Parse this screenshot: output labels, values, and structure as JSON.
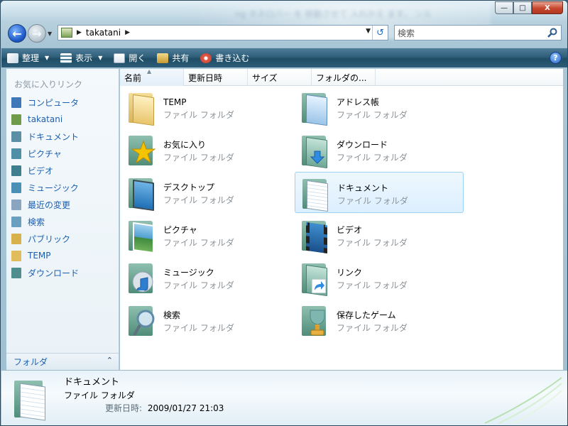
{
  "window": {
    "title_blur_text": "ng ネネロバー を 移動させて 入れかえ ます。 ンル",
    "controls": {
      "minimize": "—",
      "maximize": "□",
      "close": "X"
    }
  },
  "nav": {
    "address": {
      "crumb": "takatani"
    },
    "search": {
      "placeholder": "検索"
    }
  },
  "toolbar": {
    "organize": "整理",
    "views": "表示",
    "open": "開く",
    "share": "共有",
    "burn": "書き込む",
    "help": "?"
  },
  "sidebar": {
    "title": "お気に入りリンク",
    "items": [
      {
        "label": "コンピュータ",
        "icon": "computer-icon",
        "color": "#3f78b8"
      },
      {
        "label": "takatani",
        "icon": "user-folder-icon",
        "color": "#6f9c4a"
      },
      {
        "label": "ドキュメント",
        "icon": "documents-icon",
        "color": "#5a8fa6"
      },
      {
        "label": "ピクチャ",
        "icon": "pictures-icon",
        "color": "#4f8fa8"
      },
      {
        "label": "ビデオ",
        "icon": "videos-icon",
        "color": "#3f7e8f"
      },
      {
        "label": "ミュージック",
        "icon": "music-icon",
        "color": "#4a8fb5"
      },
      {
        "label": "最近の変更",
        "icon": "recent-icon",
        "color": "#8aa5c0"
      },
      {
        "label": "検索",
        "icon": "search-folder-icon",
        "color": "#6b9fbf"
      },
      {
        "label": "パブリック",
        "icon": "public-folder-icon",
        "color": "#d9b14a"
      },
      {
        "label": "TEMP",
        "icon": "folder-icon",
        "color": "#e0bd5a"
      },
      {
        "label": "ダウンロード",
        "icon": "downloads-icon",
        "color": "#4f8d8f"
      }
    ],
    "folders_label": "フォルダ"
  },
  "columns": [
    "名前",
    "更新日時",
    "サイズ",
    "フォルダの..."
  ],
  "files": [
    {
      "name": "TEMP",
      "type": "ファイル フォルダ",
      "icon": "plain-folder-icon"
    },
    {
      "name": "アドレス帳",
      "type": "ファイル フォルダ",
      "icon": "contacts-folder-icon"
    },
    {
      "name": "お気に入り",
      "type": "ファイル フォルダ",
      "icon": "favorites-folder-icon"
    },
    {
      "name": "ダウンロード",
      "type": "ファイル フォルダ",
      "icon": "downloads-folder-icon"
    },
    {
      "name": "デスクトップ",
      "type": "ファイル フォルダ",
      "icon": "desktop-folder-icon"
    },
    {
      "name": "ドキュメント",
      "type": "ファイル フォルダ",
      "icon": "documents-folder-icon"
    },
    {
      "name": "ピクチャ",
      "type": "ファイル フォルダ",
      "icon": "pictures-folder-icon"
    },
    {
      "name": "ビデオ",
      "type": "ファイル フォルダ",
      "icon": "videos-folder-icon"
    },
    {
      "name": "ミュージック",
      "type": "ファイル フォルダ",
      "icon": "music-folder-icon"
    },
    {
      "name": "リンク",
      "type": "ファイル フォルダ",
      "icon": "links-folder-icon"
    },
    {
      "name": "検索",
      "type": "ファイル フォルダ",
      "icon": "searches-folder-icon"
    },
    {
      "name": "保存したゲーム",
      "type": "ファイル フォルダ",
      "icon": "saved-games-folder-icon"
    }
  ],
  "details": {
    "name": "ドキュメント",
    "type": "ファイル フォルダ",
    "modified_label": "更新日時:",
    "modified_value": "2009/01/27 21:03"
  }
}
